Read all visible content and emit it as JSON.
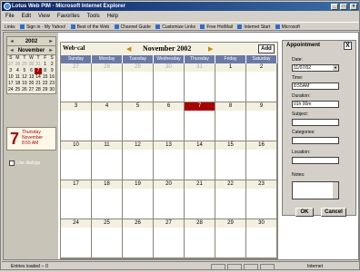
{
  "window": {
    "title": "Lotus Web PIM - Microsoft Internet Explorer"
  },
  "menu": {
    "items": [
      "File",
      "Edit",
      "View",
      "Favorites",
      "Tools",
      "Help"
    ]
  },
  "links": {
    "label": "Links",
    "items": [
      "Sign in - My Yahoo!",
      "Best of the Web",
      "Channel Guide",
      "Customize Links",
      "Free HotMail",
      "Internet Start",
      "Microsoft"
    ]
  },
  "minical": {
    "year": "2002",
    "month": "November",
    "dow": [
      "S",
      "M",
      "T",
      "W",
      "T",
      "F",
      "S"
    ],
    "days": [
      "27",
      "28",
      "29",
      "30",
      "31",
      "1",
      "2",
      "3",
      "4",
      "5",
      "6",
      "7",
      "8",
      "9",
      "10",
      "11",
      "12",
      "13",
      "14",
      "15",
      "16",
      "17",
      "18",
      "19",
      "20",
      "21",
      "22",
      "23",
      "24",
      "25",
      "26",
      "27",
      "28",
      "29",
      "30"
    ],
    "selected": "7"
  },
  "today": {
    "day": "7",
    "weekday": "Thursday",
    "month": "November",
    "time": "8:55 AM"
  },
  "use_dialogs": "Use dialogs",
  "calendar": {
    "app": "Web·cal",
    "title": "November 2002",
    "add": "Add",
    "dow": [
      "Sunday",
      "Monday",
      "Tuesday",
      "Wednesday",
      "Thursday",
      "Friday",
      "Saturday"
    ],
    "cells": [
      "27",
      "28",
      "29",
      "30",
      "31",
      "1",
      "2",
      "3",
      "4",
      "5",
      "6",
      "7",
      "8",
      "9",
      "10",
      "11",
      "12",
      "13",
      "14",
      "15",
      "16",
      "17",
      "18",
      "19",
      "20",
      "21",
      "22",
      "23",
      "24",
      "25",
      "26",
      "27",
      "28",
      "29",
      "30"
    ],
    "today": "7"
  },
  "appointment": {
    "title": "Appointment",
    "close": "X",
    "date_label": "Date:",
    "date_value": "11/07/02",
    "time_label": "Time:",
    "time_value": "8:55AM",
    "duration_label": "Duration:",
    "duration_value": "01h 00m",
    "subject_label": "Subject:",
    "categories_label": "Categories:",
    "location_label": "Location:",
    "notes_label": "Notes:",
    "ok": "OK",
    "cancel": "Cancel"
  },
  "status": {
    "left": "Entries loaded -- 0",
    "right": "Internet"
  }
}
